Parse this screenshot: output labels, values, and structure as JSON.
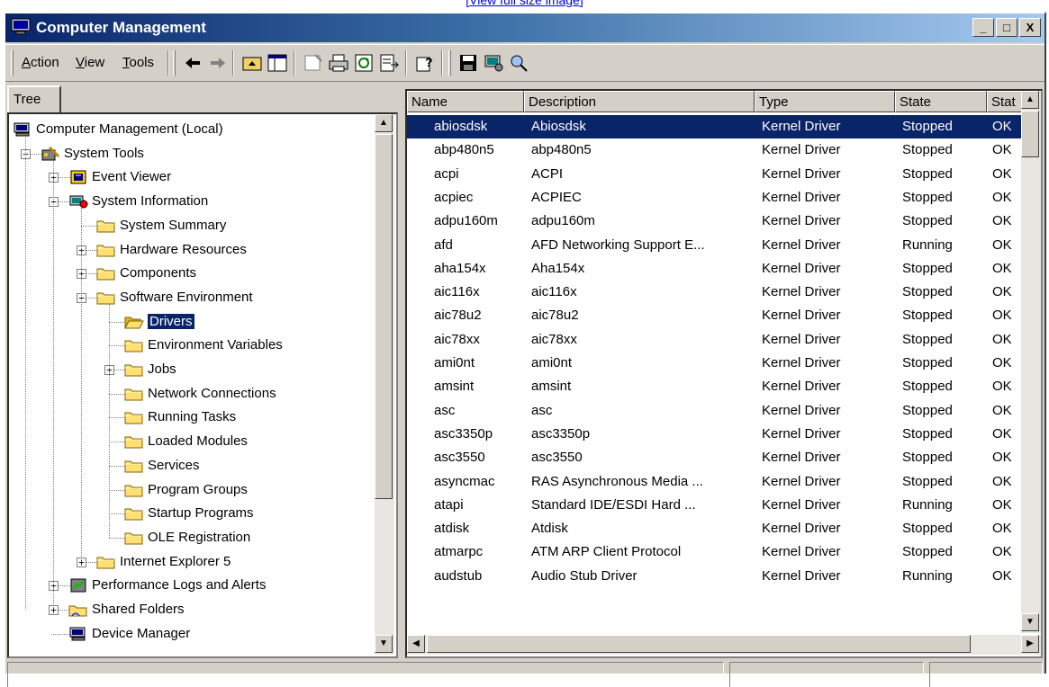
{
  "top_link": "[View full size image]",
  "window": {
    "title": "Computer Management"
  },
  "title_buttons": {
    "minimize": "_",
    "restore": "□",
    "close": "X"
  },
  "menu": {
    "action": "Action",
    "view": "View",
    "tools": "Tools"
  },
  "menu_accel": {
    "action": "A",
    "view": "V",
    "tools": "T"
  },
  "tree_tab": "Tree",
  "tree": [
    {
      "label": "Computer Management (Local)",
      "icon": "computer-icon",
      "level": 0,
      "expander": ""
    },
    {
      "label": "System Tools",
      "icon": "tools-icon",
      "level": 1,
      "expander": "-"
    },
    {
      "label": "Event Viewer",
      "icon": "event-viewer-icon",
      "level": 2,
      "expander": "+"
    },
    {
      "label": "System Information",
      "icon": "system-info-icon",
      "level": 2,
      "expander": "-"
    },
    {
      "label": "System Summary",
      "icon": "folder-icon",
      "level": 3,
      "expander": ""
    },
    {
      "label": "Hardware Resources",
      "icon": "folder-icon",
      "level": 3,
      "expander": "+"
    },
    {
      "label": "Components",
      "icon": "folder-icon",
      "level": 3,
      "expander": "+"
    },
    {
      "label": "Software Environment",
      "icon": "folder-icon",
      "level": 3,
      "expander": "-"
    },
    {
      "label": "Drivers",
      "icon": "open-folder-icon",
      "level": 4,
      "expander": "",
      "selected": true
    },
    {
      "label": "Environment Variables",
      "icon": "folder-icon",
      "level": 4,
      "expander": ""
    },
    {
      "label": "Jobs",
      "icon": "folder-icon",
      "level": 4,
      "expander": "+"
    },
    {
      "label": "Network Connections",
      "icon": "folder-icon",
      "level": 4,
      "expander": ""
    },
    {
      "label": "Running Tasks",
      "icon": "folder-icon",
      "level": 4,
      "expander": ""
    },
    {
      "label": "Loaded Modules",
      "icon": "folder-icon",
      "level": 4,
      "expander": ""
    },
    {
      "label": "Services",
      "icon": "folder-icon",
      "level": 4,
      "expander": ""
    },
    {
      "label": "Program Groups",
      "icon": "folder-icon",
      "level": 4,
      "expander": ""
    },
    {
      "label": "Startup Programs",
      "icon": "folder-icon",
      "level": 4,
      "expander": ""
    },
    {
      "label": "OLE Registration",
      "icon": "folder-icon",
      "level": 4,
      "expander": ""
    },
    {
      "label": "Internet Explorer 5",
      "icon": "folder-icon",
      "level": 3,
      "expander": "+"
    },
    {
      "label": "Performance Logs and Alerts",
      "icon": "performance-icon",
      "level": 2,
      "expander": "+"
    },
    {
      "label": "Shared Folders",
      "icon": "shared-folder-icon",
      "level": 2,
      "expander": "+"
    },
    {
      "label": "Device Manager",
      "icon": "device-manager-icon",
      "level": 2,
      "expander": ""
    }
  ],
  "columns": [
    "Name",
    "Description",
    "Type",
    "State",
    "Stat"
  ],
  "rows": [
    [
      "abiosdsk",
      "Abiosdsk",
      "Kernel Driver",
      "Stopped",
      "OK"
    ],
    [
      "abp480n5",
      "abp480n5",
      "Kernel Driver",
      "Stopped",
      "OK"
    ],
    [
      "acpi",
      "ACPI",
      "Kernel Driver",
      "Stopped",
      "OK"
    ],
    [
      "acpiec",
      "ACPIEC",
      "Kernel Driver",
      "Stopped",
      "OK"
    ],
    [
      "adpu160m",
      "adpu160m",
      "Kernel Driver",
      "Stopped",
      "OK"
    ],
    [
      "afd",
      "AFD Networking Support E...",
      "Kernel Driver",
      "Running",
      "OK"
    ],
    [
      "aha154x",
      "Aha154x",
      "Kernel Driver",
      "Stopped",
      "OK"
    ],
    [
      "aic116x",
      "aic116x",
      "Kernel Driver",
      "Stopped",
      "OK"
    ],
    [
      "aic78u2",
      "aic78u2",
      "Kernel Driver",
      "Stopped",
      "OK"
    ],
    [
      "aic78xx",
      "aic78xx",
      "Kernel Driver",
      "Stopped",
      "OK"
    ],
    [
      "ami0nt",
      "ami0nt",
      "Kernel Driver",
      "Stopped",
      "OK"
    ],
    [
      "amsint",
      "amsint",
      "Kernel Driver",
      "Stopped",
      "OK"
    ],
    [
      "asc",
      "asc",
      "Kernel Driver",
      "Stopped",
      "OK"
    ],
    [
      "asc3350p",
      "asc3350p",
      "Kernel Driver",
      "Stopped",
      "OK"
    ],
    [
      "asc3550",
      "asc3550",
      "Kernel Driver",
      "Stopped",
      "OK"
    ],
    [
      "asyncmac",
      "RAS Asynchronous Media ...",
      "Kernel Driver",
      "Stopped",
      "OK"
    ],
    [
      "atapi",
      "Standard IDE/ESDI Hard ...",
      "Kernel Driver",
      "Running",
      "OK"
    ],
    [
      "atdisk",
      "Atdisk",
      "Kernel Driver",
      "Stopped",
      "OK"
    ],
    [
      "atmarpc",
      "ATM ARP Client Protocol",
      "Kernel Driver",
      "Stopped",
      "OK"
    ],
    [
      "audstub",
      "Audio Stub Driver",
      "Kernel Driver",
      "Running",
      "OK"
    ]
  ],
  "selected_row": 0,
  "colors": {
    "title_start": "#0a246a",
    "title_end": "#a6caf0",
    "chrome": "#d4d0c8",
    "selection": "#0a246a"
  }
}
